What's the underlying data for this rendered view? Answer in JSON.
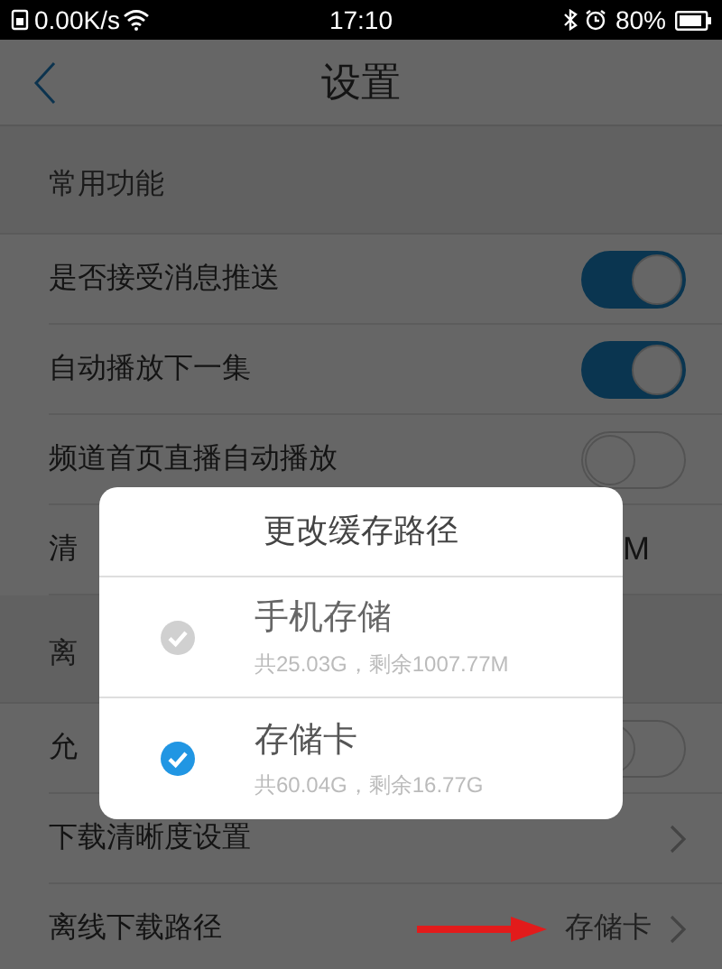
{
  "status_bar": {
    "network_speed": "0.00K/s",
    "time": "17:10",
    "battery": "80%"
  },
  "header": {
    "title": "设置"
  },
  "sections": [
    {
      "title": "常用功能",
      "rows": [
        {
          "kind": "toggle",
          "label": "是否接受消息推送",
          "on": true
        },
        {
          "kind": "toggle",
          "label": "自动播放下一集",
          "on": true
        },
        {
          "kind": "toggle",
          "label": "频道首页直播自动播放",
          "on": false
        },
        {
          "kind": "value",
          "label": "清",
          "value": "M"
        }
      ]
    },
    {
      "title": "离",
      "rows": [
        {
          "kind": "toggle",
          "label": "允",
          "on": false
        },
        {
          "kind": "link",
          "label": "下载清晰度设置"
        },
        {
          "kind": "link",
          "label": "离线下载路径",
          "value": "存储卡",
          "annotated": true
        }
      ]
    }
  ],
  "dialog": {
    "title": "更改缓存路径",
    "options": [
      {
        "name": "手机存储",
        "detail": "共25.03G，剩余1007.77M",
        "selected": false
      },
      {
        "name": "存储卡",
        "detail": "共60.04G，剩余16.77G",
        "selected": true
      }
    ]
  }
}
